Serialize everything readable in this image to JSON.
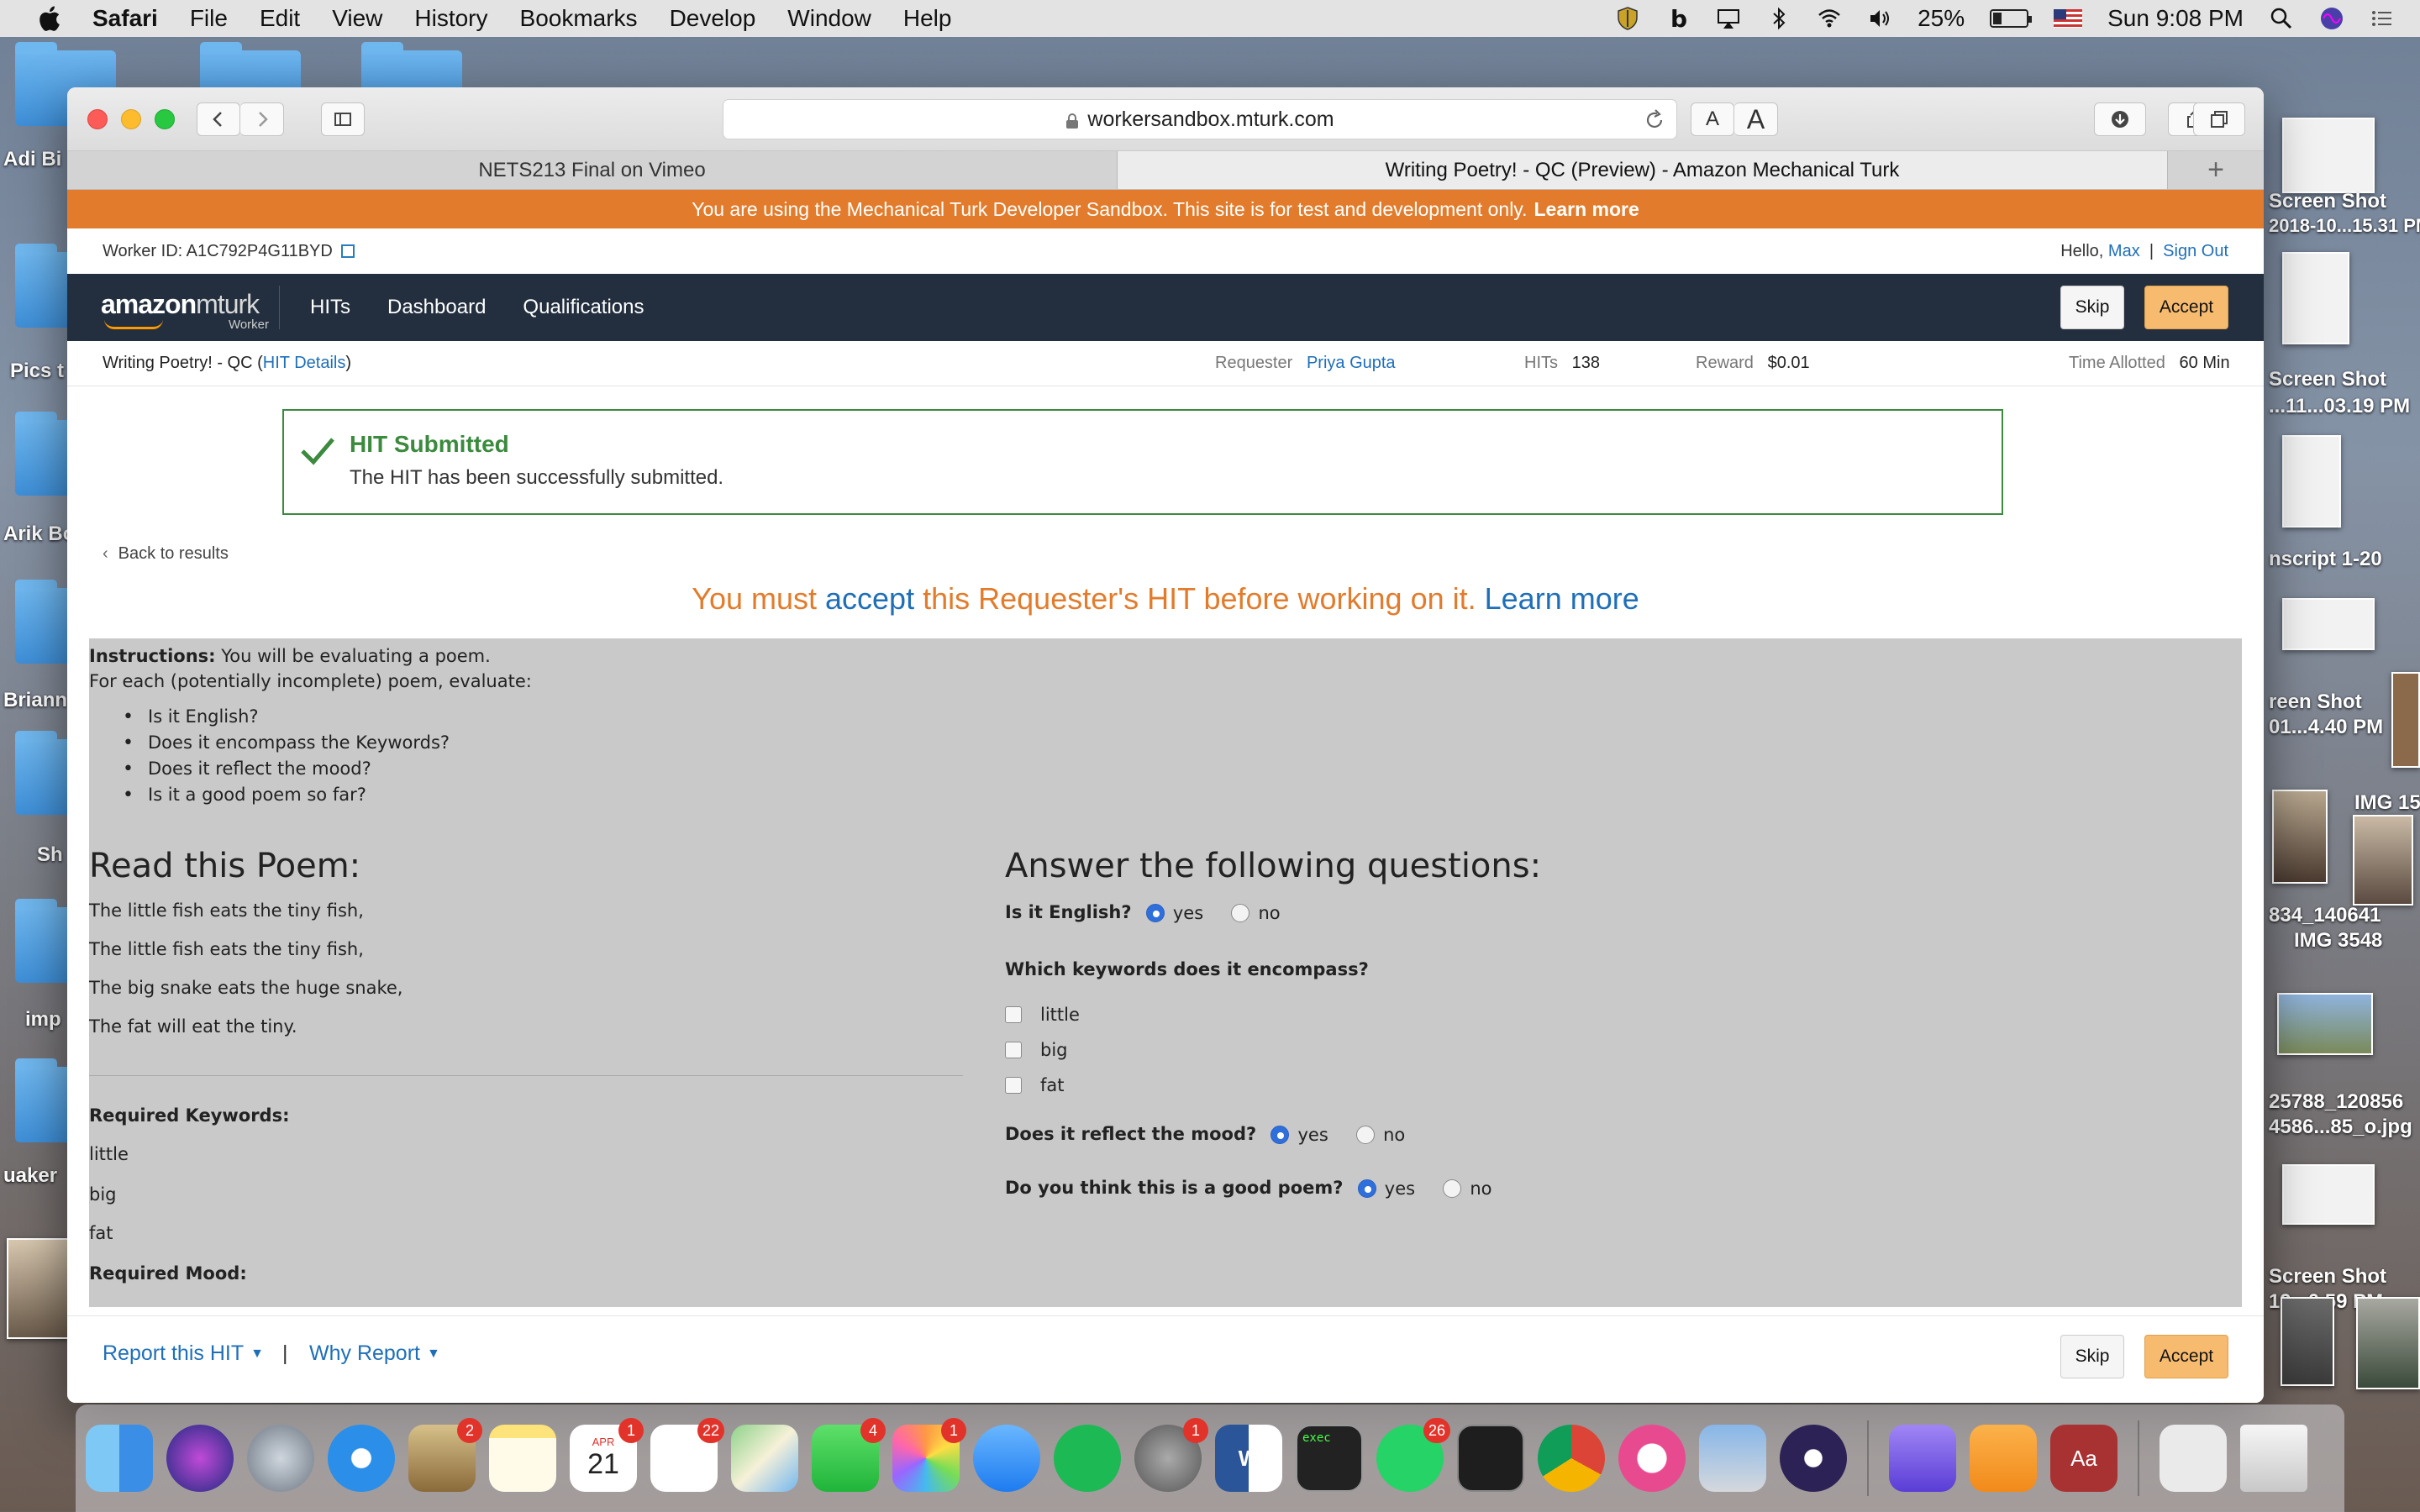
{
  "menubar": {
    "app": "Safari",
    "items": [
      "File",
      "Edit",
      "View",
      "History",
      "Bookmarks",
      "Develop",
      "Window",
      "Help"
    ],
    "battery_percent": "25%",
    "clock": "Sun 9:08 PM"
  },
  "desktop": {
    "labels_left": [
      "Adi Bi",
      "Pics t",
      "Arik Bo",
      "Briann",
      "Sh",
      "imp",
      "uaker"
    ],
    "labels_right": [
      "Screen Shot",
      "Screen Shot",
      "reen Shot",
      "nscript 1-20",
      "reen Shot",
      "IMG 15",
      "834_140641",
      "IMG 3548",
      "25788_120856",
      "4586...85_o.jpg",
      "Screen Shot"
    ],
    "label_right_sub": [
      "2018-10...15.31 PM",
      "...11...03.19 PM",
      "01...4.40 PM",
      "19...0.59 PM"
    ]
  },
  "browser": {
    "url": "workersandbox.mturk.com",
    "tabs": [
      {
        "label": "NETS213 Final on Vimeo",
        "active": false
      },
      {
        "label": "Writing Poetry! - QC (Preview) - Amazon Mechanical Turk",
        "active": true
      }
    ],
    "font_small": "A",
    "font_large": "A"
  },
  "sandbox_banner": {
    "text": "You are using the Mechanical Turk Developer Sandbox. This site is for test and development only.",
    "link": "Learn more"
  },
  "worker_bar": {
    "worker_id": "Worker ID: A1C792P4G11BYD",
    "hello": "Hello,",
    "user": "Max",
    "separator": "|",
    "sign_out": "Sign Out"
  },
  "navbar": {
    "logo_amazon": "amazon",
    "logo_mturk": "mturk",
    "logo_worker": "Worker",
    "links": [
      "HITs",
      "Dashboard",
      "Qualifications"
    ],
    "skip": "Skip",
    "accept": "Accept"
  },
  "hit_bar": {
    "title": "Writing Poetry! - QC",
    "open_paren": "(",
    "details_link": "HIT Details",
    "close_paren": ")",
    "requester_label": "Requester",
    "requester": "Priya Gupta",
    "hits_label": "HITs",
    "hits": "138",
    "reward_label": "Reward",
    "reward": "$0.01",
    "time_label": "Time Allotted",
    "time": "60 Min"
  },
  "alert": {
    "title": "HIT Submitted",
    "message": "The HIT has been successfully submitted."
  },
  "back_link": "Back to results",
  "must_accept": {
    "pre": "You must",
    "link": "accept",
    "post": "this Requester's HIT before working on it.",
    "learn": "Learn more"
  },
  "task": {
    "instructions_label": "Instructions:",
    "instructions_text": "You will be evaluating a poem.",
    "instructions_line2": "For each (potentially incomplete) poem, evaluate:",
    "bullets": [
      "Is it English?",
      "Does it encompass the Keywords?",
      "Does it reflect the mood?",
      "Is it a good poem so far?"
    ],
    "poem_heading": "Read this Poem:",
    "poem_lines": [
      "The little fish eats the tiny fish,",
      "The little fish eats the tiny fish,",
      "The big snake eats the huge snake,",
      "The fat will eat the tiny."
    ],
    "keywords_heading": "Required Keywords:",
    "keywords": [
      "little",
      "big",
      "fat"
    ],
    "mood_heading": "Required Mood:",
    "answer_heading": "Answer the following questions:",
    "q_english": "Is it English?",
    "q_keywords": "Which keywords does it encompass?",
    "q_mood": "Does it reflect the mood?",
    "q_good": "Do you think this is a good poem?",
    "yes": "yes",
    "no": "no",
    "checkbox_options": [
      "little",
      "big",
      "fat"
    ]
  },
  "footer": {
    "report": "Report this HIT",
    "separator": "|",
    "why": "Why Report",
    "skip": "Skip",
    "accept": "Accept"
  },
  "dock": {
    "badges": {
      "mail": "2",
      "calendar": "1",
      "reminders": "22",
      "facetime": "4",
      "photos": "1",
      "prefs": "1",
      "whatsapp": "26"
    },
    "calendar_month": "APR",
    "calendar_day": "21",
    "terminal_text": "exec"
  },
  "colors": {
    "banner": "#e27c2c",
    "navbar": "#232f3e",
    "link": "#1f6fb8",
    "success": "#3b8a3e",
    "accept_button": "#f6bb6f",
    "task_bg": "#c9c9c9"
  }
}
